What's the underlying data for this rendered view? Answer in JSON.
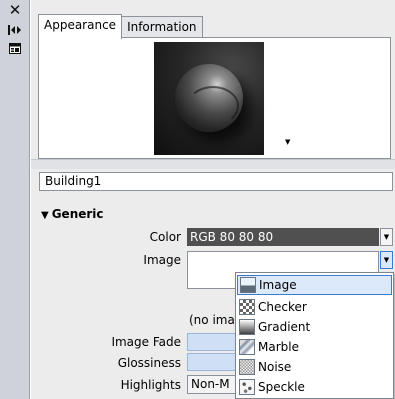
{
  "toolstrip": {
    "close_icon": "✕",
    "pin_icon": "↔",
    "dock_icon": "▤"
  },
  "tabs": [
    {
      "label": "Appearance",
      "active": true
    },
    {
      "label": "Information",
      "active": false
    }
  ],
  "material_name": "Building1",
  "section": {
    "title": "Generic",
    "toggle": "▼"
  },
  "properties": {
    "color_label": "Color",
    "color_value": "RGB 80 80 80",
    "color_swatch": "#505050",
    "image_label": "Image",
    "image_status": "(no ima",
    "image_fade_label": "Image Fade",
    "glossiness_label": "Glossiness",
    "highlights_label": "Highlights",
    "highlights_value": "Non-M"
  },
  "image_menu": {
    "items": [
      {
        "label": "Image",
        "icon": "image-icon",
        "selected": true
      },
      {
        "label": "Checker",
        "icon": "checker-icon",
        "selected": false
      },
      {
        "label": "Gradient",
        "icon": "gradient-icon",
        "selected": false
      },
      {
        "label": "Marble",
        "icon": "marble-icon",
        "selected": false
      },
      {
        "label": "Noise",
        "icon": "noise-icon",
        "selected": false
      },
      {
        "label": "Speckle",
        "icon": "speckle-icon",
        "selected": false
      }
    ]
  },
  "colors": {
    "selection_border": "#3a7bd5",
    "selection_fill": "#dbe9fb",
    "panel_bg": "#ececec"
  }
}
